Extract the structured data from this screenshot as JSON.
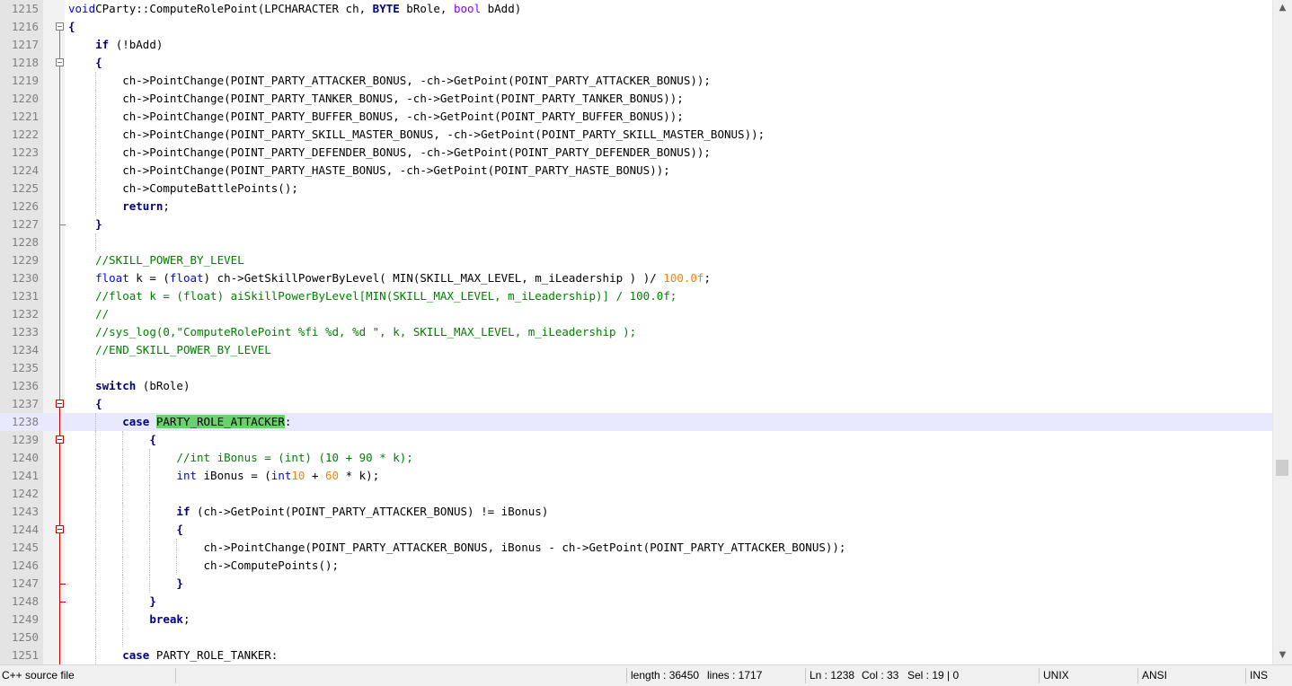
{
  "editor": {
    "language_keywords": [
      "void",
      "if",
      "float",
      "int",
      "switch",
      "case",
      "break",
      "return",
      "BYTE",
      "bool"
    ],
    "lines": [
      {
        "n": "1215",
        "segs": [
          [
            "kw",
            "void"
          ],
          [
            "",
            "CParty::ComputeRolePoint(LPCHARACTER ch, "
          ],
          [
            "kwb",
            "BYTE"
          ],
          [
            "",
            " bRole, "
          ],
          [
            "typ",
            "bool"
          ],
          [
            "",
            " bAdd)"
          ]
        ]
      },
      {
        "n": "1216",
        "segs": [
          [
            "op",
            "{"
          ]
        ]
      },
      {
        "n": "1217",
        "segs": [
          [
            "",
            "    "
          ],
          [
            "kwb",
            "if"
          ],
          [
            "",
            " (!bAdd)"
          ]
        ]
      },
      {
        "n": "1218",
        "segs": [
          [
            "",
            "    "
          ],
          [
            "op",
            "{"
          ]
        ]
      },
      {
        "n": "1219",
        "segs": [
          [
            "",
            "        ch->PointChange(POINT_PARTY_ATTACKER_BONUS, -ch->GetPoint(POINT_PARTY_ATTACKER_BONUS));"
          ]
        ]
      },
      {
        "n": "1220",
        "segs": [
          [
            "",
            "        ch->PointChange(POINT_PARTY_TANKER_BONUS, -ch->GetPoint(POINT_PARTY_TANKER_BONUS));"
          ]
        ]
      },
      {
        "n": "1221",
        "segs": [
          [
            "",
            "        ch->PointChange(POINT_PARTY_BUFFER_BONUS, -ch->GetPoint(POINT_PARTY_BUFFER_BONUS));"
          ]
        ]
      },
      {
        "n": "1222",
        "segs": [
          [
            "",
            "        ch->PointChange(POINT_PARTY_SKILL_MASTER_BONUS, -ch->GetPoint(POINT_PARTY_SKILL_MASTER_BONUS));"
          ]
        ]
      },
      {
        "n": "1223",
        "segs": [
          [
            "",
            "        ch->PointChange(POINT_PARTY_DEFENDER_BONUS, -ch->GetPoint(POINT_PARTY_DEFENDER_BONUS));"
          ]
        ]
      },
      {
        "n": "1224",
        "segs": [
          [
            "",
            "        ch->PointChange(POINT_PARTY_HASTE_BONUS, -ch->GetPoint(POINT_PARTY_HASTE_BONUS));"
          ]
        ]
      },
      {
        "n": "1225",
        "segs": [
          [
            "",
            "        ch->ComputeBattlePoints();"
          ]
        ]
      },
      {
        "n": "1226",
        "segs": [
          [
            "",
            "        "
          ],
          [
            "kwb",
            "return"
          ],
          [
            "",
            ";"
          ]
        ]
      },
      {
        "n": "1227",
        "segs": [
          [
            "",
            "    "
          ],
          [
            "op",
            "}"
          ]
        ]
      },
      {
        "n": "1228",
        "segs": []
      },
      {
        "n": "1229",
        "segs": [
          [
            "",
            "    "
          ],
          [
            "cmt",
            "//SKILL_POWER_BY_LEVEL"
          ]
        ]
      },
      {
        "n": "1230",
        "segs": [
          [
            "",
            "    "
          ],
          [
            "kw",
            "float"
          ],
          [
            "",
            " k = ("
          ],
          [
            "kw",
            "float"
          ],
          [
            "",
            ") ch->GetSkillPowerByLevel( MIN(SKILL_MAX_LEVEL, m_iLeadership ) )/ "
          ],
          [
            "num",
            "100.0f"
          ],
          [
            "",
            ";"
          ]
        ]
      },
      {
        "n": "1231",
        "segs": [
          [
            "",
            "    "
          ],
          [
            "cmt",
            "//float k = (float) aiSkillPowerByLevel[MIN(SKILL_MAX_LEVEL, m_iLeadership)] / 100.0f;"
          ]
        ]
      },
      {
        "n": "1232",
        "segs": [
          [
            "",
            "    "
          ],
          [
            "cmt",
            "//"
          ]
        ]
      },
      {
        "n": "1233",
        "segs": [
          [
            "",
            "    "
          ],
          [
            "cmt",
            "//sys_log(0,\"ComputeRolePoint %fi %d, %d \", k, SKILL_MAX_LEVEL, m_iLeadership );"
          ]
        ]
      },
      {
        "n": "1234",
        "segs": [
          [
            "",
            "    "
          ],
          [
            "cmt",
            "//END_SKILL_POWER_BY_LEVEL"
          ]
        ]
      },
      {
        "n": "1235",
        "segs": []
      },
      {
        "n": "1236",
        "segs": [
          [
            "",
            "    "
          ],
          [
            "kwb",
            "switch"
          ],
          [
            "",
            " (bRole)"
          ]
        ]
      },
      {
        "n": "1237",
        "segs": [
          [
            "",
            "    "
          ],
          [
            "op",
            "{"
          ]
        ]
      },
      {
        "n": "1238",
        "segs": [
          [
            "",
            "        "
          ],
          [
            "kwb",
            "case"
          ],
          [
            "",
            " "
          ],
          [
            "hl",
            "PARTY_ROLE_ATTACKER"
          ],
          [
            "",
            ":"
          ]
        ],
        "active": true
      },
      {
        "n": "1239",
        "segs": [
          [
            "",
            "            "
          ],
          [
            "op",
            "{"
          ]
        ]
      },
      {
        "n": "1240",
        "segs": [
          [
            "",
            "                "
          ],
          [
            "cmt",
            "//int iBonus = (int) (10 + 90 * k);"
          ]
        ]
      },
      {
        "n": "1241",
        "segs": [
          [
            "",
            "                "
          ],
          [
            "kw",
            "int"
          ],
          [
            "",
            " iBonus = ("
          ],
          [
            "kw",
            "int"
          ],
          [
            ") ("
          ],
          [
            "num",
            "10"
          ],
          [
            "",
            " + "
          ],
          [
            "num",
            "60"
          ],
          [
            "",
            " * k);"
          ]
        ]
      },
      {
        "n": "1242",
        "segs": []
      },
      {
        "n": "1243",
        "segs": [
          [
            "",
            "                "
          ],
          [
            "kwb",
            "if"
          ],
          [
            "",
            " (ch->GetPoint(POINT_PARTY_ATTACKER_BONUS) != iBonus)"
          ]
        ]
      },
      {
        "n": "1244",
        "segs": [
          [
            "",
            "                "
          ],
          [
            "op",
            "{"
          ]
        ]
      },
      {
        "n": "1245",
        "segs": [
          [
            "",
            "                    ch->PointChange(POINT_PARTY_ATTACKER_BONUS, iBonus - ch->GetPoint(POINT_PARTY_ATTACKER_BONUS));"
          ]
        ]
      },
      {
        "n": "1246",
        "segs": [
          [
            "",
            "                    ch->ComputePoints();"
          ]
        ]
      },
      {
        "n": "1247",
        "segs": [
          [
            "",
            "                "
          ],
          [
            "op",
            "}"
          ]
        ]
      },
      {
        "n": "1248",
        "segs": [
          [
            "",
            "            "
          ],
          [
            "op",
            "}"
          ]
        ]
      },
      {
        "n": "1249",
        "segs": [
          [
            "",
            "            "
          ],
          [
            "kwb",
            "break"
          ],
          [
            "",
            ";"
          ]
        ]
      },
      {
        "n": "1250",
        "segs": []
      },
      {
        "n": "1251",
        "segs": [
          [
            "",
            "        "
          ],
          [
            "kwb",
            "case"
          ],
          [
            "",
            " PARTY_ROLE_TANKER:"
          ]
        ]
      }
    ]
  },
  "statusbar": {
    "file_type": "C++ source file",
    "length": "length : 36450",
    "lines": "lines : 1717",
    "ln": "Ln : 1238",
    "col": "Col : 33",
    "sel": "Sel : 19 | 0",
    "eol": "UNIX",
    "encoding": "ANSI",
    "mode": "INS"
  },
  "icons": {
    "scroll_up": "scroll-up-arrow-icon",
    "scroll_down": "scroll-down-arrow-icon",
    "fold": "fold-minus-icon"
  },
  "colors": {
    "keyword": "#0000ff",
    "keyword_bold": "#000080",
    "type": "#8000ff",
    "number": "#ff8000",
    "comment": "#008000",
    "active_line": "#e8e8ff",
    "selection_highlight": "#6ccf72",
    "fold_red": "#d00000",
    "fold_grey": "#808080"
  }
}
